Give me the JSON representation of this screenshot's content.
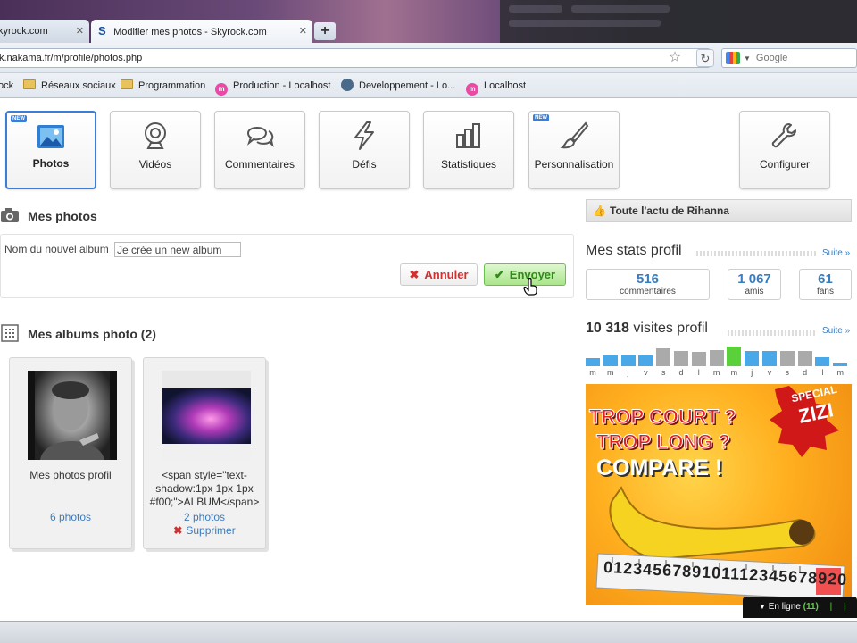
{
  "browser": {
    "tabs": [
      {
        "title": "kyrock.com"
      },
      {
        "title": "Modifier mes photos - Skyrock.com"
      }
    ],
    "new_tab": "+",
    "url": "k.nakama.fr/m/profile/photos.php",
    "search_placeholder": "Google",
    "bookmarks": [
      {
        "label": "ock",
        "icon": "none"
      },
      {
        "label": "Réseaux sociaux",
        "icon": "folder-icon"
      },
      {
        "label": "Programmation",
        "icon": "folder-icon"
      },
      {
        "label": "Production - Localhost",
        "icon": "m-icon"
      },
      {
        "label": "Developpement - Lo...",
        "icon": "globe-icon"
      },
      {
        "label": "Localhost",
        "icon": "m-icon"
      }
    ]
  },
  "nav": [
    {
      "label": "Photos",
      "icon": "photo-icon",
      "active": true,
      "new": true
    },
    {
      "label": "Vidéos",
      "icon": "webcam-icon",
      "active": false,
      "new": false
    },
    {
      "label": "Commentaires",
      "icon": "comments-icon",
      "active": false,
      "new": false
    },
    {
      "label": "Défis",
      "icon": "lightning-icon",
      "active": false,
      "new": false
    },
    {
      "label": "Statistiques",
      "icon": "stats-icon",
      "active": false,
      "new": false
    },
    {
      "label": "Personnalisation",
      "icon": "brush-icon",
      "active": false,
      "new": true
    },
    {
      "label": "Configurer",
      "icon": "wrench-icon",
      "active": false,
      "new": false
    }
  ],
  "new_badge": "NEW",
  "photos_section": {
    "title": "Mes photos",
    "album_label": "Nom du nouvel album",
    "album_value": "Je crée un new album",
    "cancel_label": "Annuler",
    "send_label": "Envoyer"
  },
  "albums_section": {
    "title": "Mes albums photo (2)",
    "albums": [
      {
        "name": "Mes photos profil",
        "count": "6 photos"
      },
      {
        "name": "<span style=\"text-shadow:1px 1px 1px #f00;\">ALBUM</span>",
        "count": "2 photos",
        "delete": "Supprimer"
      }
    ]
  },
  "right": {
    "actu": "Toute l'actu de Rihanna",
    "stats_title": "Mes stats profil",
    "suite": "Suite »",
    "stats": [
      {
        "value": "516",
        "label": "commentaires"
      },
      {
        "value": "1 067",
        "label": "amis"
      },
      {
        "value": "61",
        "label": "fans"
      }
    ],
    "visits_count": "10 318",
    "visits_label": "visites profil",
    "visit_bars": [
      {
        "day": "m",
        "level": 0.35,
        "color": "#4aa8e8"
      },
      {
        "day": "m",
        "level": 0.5,
        "color": "#4aa8e8"
      },
      {
        "day": "j",
        "level": 0.5,
        "color": "#4aa8e8"
      },
      {
        "day": "v",
        "level": 0.45,
        "color": "#4aa8e8"
      },
      {
        "day": "s",
        "level": 0.75,
        "color": "#aaaaaa"
      },
      {
        "day": "d",
        "level": 0.65,
        "color": "#aaaaaa"
      },
      {
        "day": "l",
        "level": 0.6,
        "color": "#aaaaaa"
      },
      {
        "day": "m",
        "level": 0.7,
        "color": "#aaaaaa"
      },
      {
        "day": "m",
        "level": 0.85,
        "color": "#5ad03a"
      },
      {
        "day": "j",
        "level": 0.65,
        "color": "#4aa8e8"
      },
      {
        "day": "v",
        "level": 0.65,
        "color": "#4aa8e8"
      },
      {
        "day": "s",
        "level": 0.65,
        "color": "#aaaaaa"
      },
      {
        "day": "d",
        "level": 0.65,
        "color": "#aaaaaa"
      },
      {
        "day": "l",
        "level": 0.4,
        "color": "#4aa8e8"
      },
      {
        "day": "m",
        "level": 0.1,
        "color": "#4aa8e8"
      }
    ],
    "ad": {
      "badge_line1": "SPECIAL",
      "badge_line2": "ZIZI",
      "line1": "TROP COURT ?",
      "line2": "TROP LONG ?",
      "line3": "COMPARE !",
      "ruler": "0123456789101112345678920"
    },
    "online_label": "En ligne",
    "online_count": "(11)"
  }
}
